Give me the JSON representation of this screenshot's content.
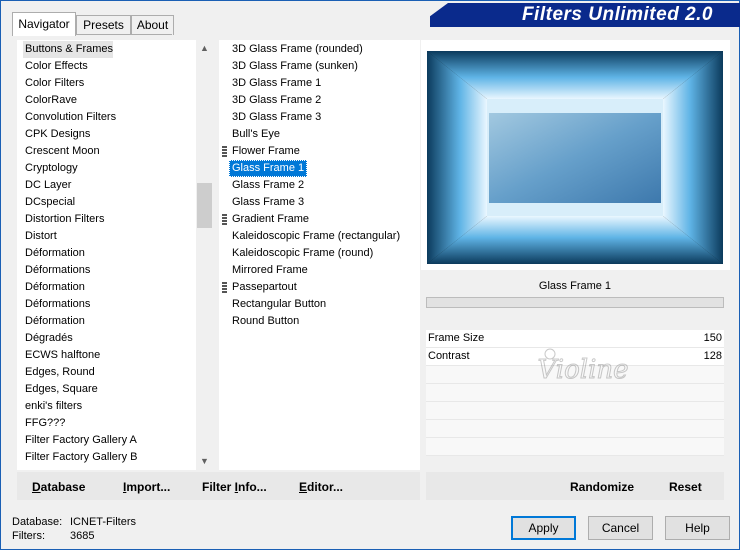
{
  "app_title": "Filters Unlimited 2.0",
  "tabs": [
    "Navigator",
    "Presets",
    "About"
  ],
  "categories": [
    "Buttons & Frames",
    "Color Effects",
    "Color Filters",
    "ColorRave",
    "Convolution Filters",
    "CPK Designs",
    "Crescent Moon",
    "Cryptology",
    "DC Layer",
    "DCspecial",
    "Distortion Filters",
    "Distort",
    "Déformation",
    "Déformations",
    "Déformation",
    "Déformations",
    "Déformation",
    "Dégradés",
    "ECWS halftone",
    "Edges, Round",
    "Edges, Square",
    "enki's filters",
    "FFG???",
    "Filter Factory Gallery A",
    "Filter Factory Gallery B"
  ],
  "filters": [
    "3D Glass Frame (rounded)",
    "3D Glass Frame (sunken)",
    "3D Glass Frame 1",
    "3D Glass Frame 2",
    "3D Glass Frame 3",
    "Bull's Eye",
    "Flower Frame",
    "Glass Frame 1",
    "Glass Frame 2",
    "Glass Frame 3",
    "Gradient Frame",
    "Kaleidoscopic Frame (rectangular)",
    "Kaleidoscopic Frame (round)",
    "Mirrored Frame",
    "Passepartout",
    "Rectangular Button",
    "Round Button"
  ],
  "selected_filter": "Glass Frame 1",
  "parameters": [
    {
      "label": "Frame Size",
      "value": "150"
    },
    {
      "label": "Contrast",
      "value": "128"
    }
  ],
  "watermark_text": "Violine",
  "bottom_left": {
    "database_prefix": "D",
    "database_rest": "atabase",
    "import_prefix": "I",
    "import_rest": "mport...",
    "filterinfo_pre": "Filter ",
    "filterinfo_u": "I",
    "filterinfo_rest": "nfo...",
    "editor_prefix": "E",
    "editor_rest": "ditor..."
  },
  "bottom_right": {
    "randomize": "Randomize",
    "reset": "Reset"
  },
  "status": {
    "database_label": "Database:",
    "database_value": "ICNET-Filters",
    "filters_label": "Filters:",
    "filters_value": "3685"
  },
  "buttons": {
    "apply": "Apply",
    "cancel": "Cancel",
    "help": "Help"
  },
  "colors": {
    "selection": "#0078d7",
    "banner": "#0a2a8c"
  }
}
